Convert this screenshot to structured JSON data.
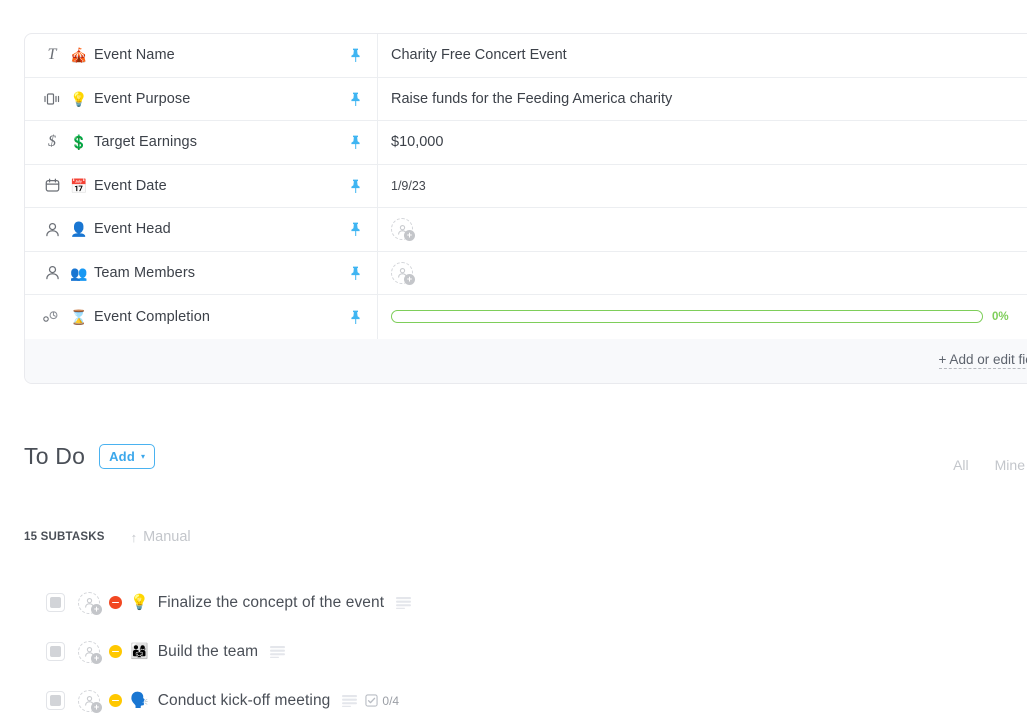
{
  "custom_fields": {
    "rows": [
      {
        "type_icon": "text-field-icon",
        "type_glyph": "T",
        "emoji": "🎪",
        "emoji_name": "circus-tent-emoji",
        "label": "Event Name",
        "pin": "pin-icon",
        "value_kind": "text",
        "value": "Charity Free Concert Event"
      },
      {
        "type_icon": "text-area-field-icon",
        "type_glyph": "",
        "emoji": "💡",
        "emoji_name": "light-bulb-emoji",
        "label": "Event Purpose",
        "pin": "pin-icon",
        "value_kind": "text",
        "value": "Raise funds for the Feeding America charity"
      },
      {
        "type_icon": "currency-field-icon",
        "type_glyph": "$",
        "emoji": "💲",
        "emoji_name": "heavy-dollar-sign-emoji",
        "label": "Target Earnings",
        "pin": "pin-icon",
        "value_kind": "text",
        "value": "$10,000"
      },
      {
        "type_icon": "date-field-icon",
        "type_glyph": "",
        "emoji": "📅",
        "emoji_name": "calendar-emoji",
        "label": "Event Date",
        "pin": "pin-icon",
        "value_kind": "date",
        "value": "1/9/23"
      },
      {
        "type_icon": "person-field-icon",
        "type_glyph": "",
        "emoji": "👤",
        "emoji_name": "bust-in-silhouette-emoji",
        "label": "Event Head",
        "pin": "pin-icon",
        "value_kind": "avatar",
        "value": ""
      },
      {
        "type_icon": "person-field-icon",
        "type_glyph": "",
        "emoji": "👥",
        "emoji_name": "busts-in-silhouette-emoji",
        "label": "Team Members",
        "pin": "pin-icon",
        "value_kind": "avatar",
        "value": ""
      },
      {
        "type_icon": "progress-field-icon",
        "type_glyph": "",
        "emoji": "⌛",
        "emoji_name": "hourglass-emoji",
        "label": "Event Completion",
        "pin": "pin-icon",
        "value_kind": "progress",
        "value": "0%",
        "progress_percent": 0
      }
    ],
    "footer": {
      "add_fields_label": "+ Add or edit fields"
    }
  },
  "todo": {
    "title": "To Do",
    "add_button": {
      "label": "Add",
      "caret": "▾"
    },
    "filters": [
      {
        "label": "All",
        "name": "filter-all"
      },
      {
        "label": "Mine",
        "name": "filter-mine"
      }
    ],
    "subtask_count_label": "15 SUBTASKS",
    "sort": {
      "arrow": "↑",
      "label": "Manual"
    },
    "subtasks": [
      {
        "checkbox": "unchecked",
        "priority_color": "#f24822",
        "priority_name": "priority-urgent",
        "emoji": "💡",
        "emoji_name": "light-bulb-emoji",
        "name": "Finalize the concept of the event",
        "has_description": true,
        "checklist": null
      },
      {
        "checkbox": "unchecked",
        "priority_color": "#ffc800",
        "priority_name": "priority-high",
        "emoji": "👨‍👩‍👧",
        "emoji_name": "family-emoji",
        "name": "Build the team",
        "has_description": true,
        "checklist": null
      },
      {
        "checkbox": "unchecked",
        "priority_color": "#ffc800",
        "priority_name": "priority-high",
        "emoji": "🗣️",
        "emoji_name": "speaking-head-emoji",
        "name": "Conduct kick-off meeting",
        "has_description": true,
        "checklist": "0/4"
      }
    ]
  },
  "colors": {
    "pin": "#3fb5f2",
    "accent_blue": "#3ba7eb",
    "progress_green": "#7ece5a",
    "text_primary": "#4a4f57",
    "text_muted": "#c3c6cb",
    "border": "#eceef1",
    "footer_bg": "#f8f9fb"
  }
}
